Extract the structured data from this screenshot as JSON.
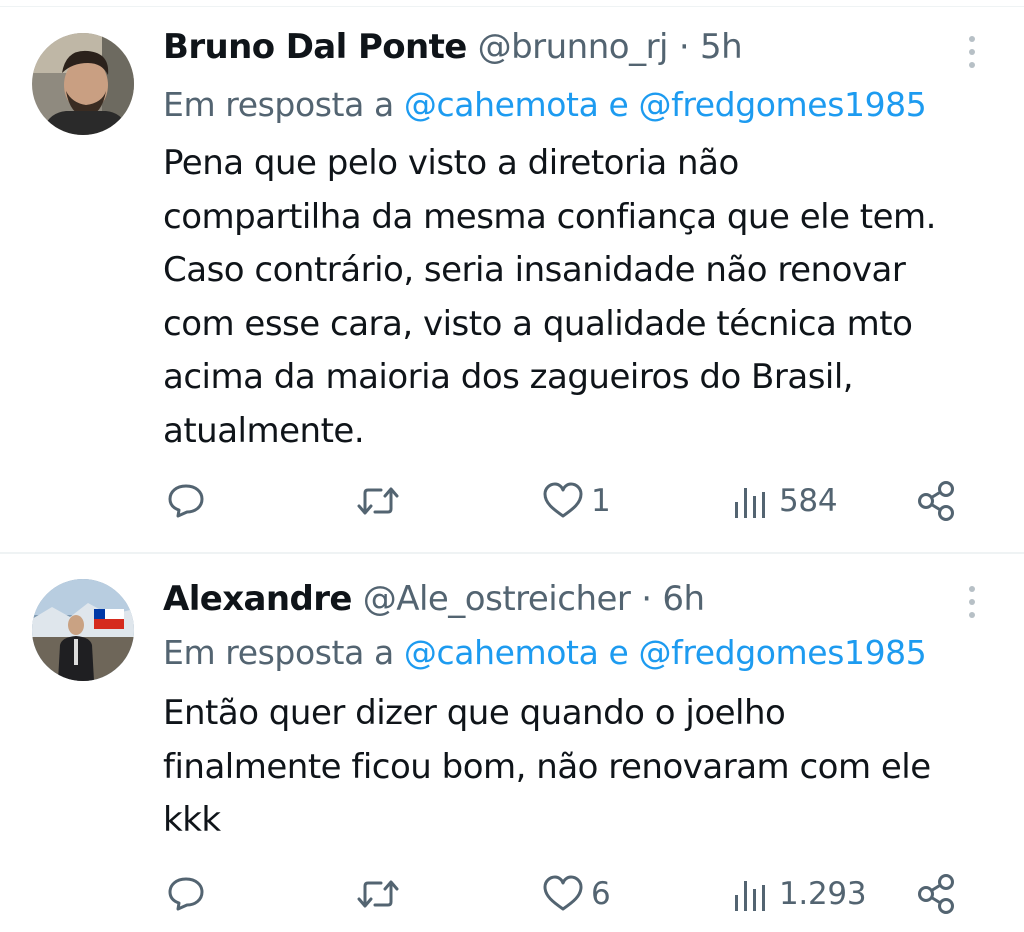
{
  "tweets": [
    {
      "display_name": "Bruno Dal Ponte",
      "handle": "@brunno_rj",
      "separator": "·",
      "time": "5h",
      "reply_prefix": "Em resposta a",
      "mention_1": "@cahemota",
      "reply_joiner": "e",
      "mention_2": "@fredgomes1985",
      "text_lines": [
        "Pena que pelo visto a diretoria não",
        "compartilha da mesma confiança que ele tem.",
        "Caso contrário, seria insanidade não renovar",
        "com esse cara, visto a qualidade técnica mto",
        "acima da maioria dos zagueiros do Brasil,",
        "atualmente."
      ],
      "likes": "1",
      "views": "584"
    },
    {
      "display_name": "Alexandre",
      "handle": "@Ale_ostreicher",
      "separator": "·",
      "time": "6h",
      "reply_prefix": "Em resposta a",
      "mention_1": "@cahemota",
      "reply_joiner": "e",
      "mention_2": "@fredgomes1985",
      "text_lines": [
        "Então quer dizer que quando o joelho",
        "finalmente ficou bom, não renovaram com ele",
        "kkk"
      ],
      "likes": "6",
      "views": "1.293"
    }
  ],
  "icons": {
    "reply": "reply-icon",
    "retweet": "retweet-icon",
    "like": "heart-icon",
    "views": "views-icon",
    "share": "share-icon",
    "more": "more-icon"
  },
  "colors": {
    "text": "#0f1419",
    "secondary": "#536471",
    "mention": "#1d9bf0",
    "divider": "#eff3f4",
    "more_dots": "#b7c0c6"
  }
}
